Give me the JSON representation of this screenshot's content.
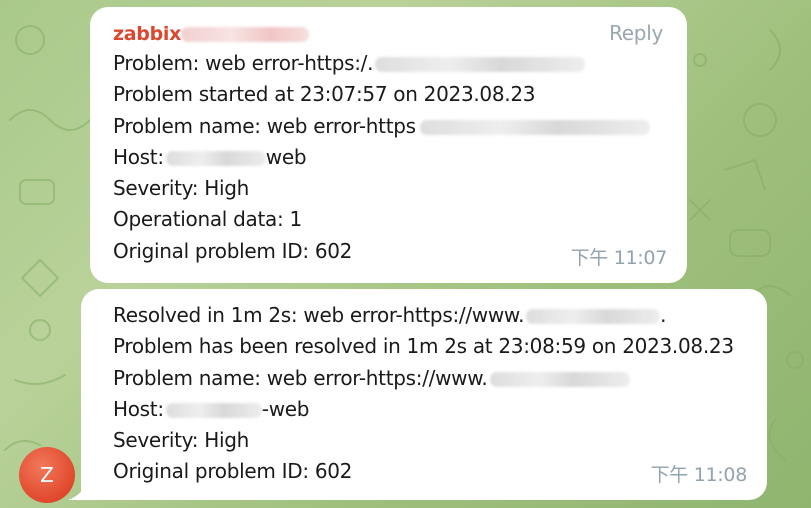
{
  "colors": {
    "wallpaper": "#a9c98a",
    "bubble": "#ffffff",
    "sender": "#d9482f",
    "meta": "#93a3ae",
    "avatar": "#e0482c"
  },
  "message_1": {
    "sender": "zabbix",
    "reply_label": "Reply",
    "lines": {
      "problem": "Problem: web error-https:/.",
      "started": "Problem started at 23:07:57 on 2023.08.23",
      "name": "Problem name: web error-https",
      "host_prefix": "Host:",
      "host_suffix": "web",
      "severity": "Severity: High",
      "operational": "Operational data: 1",
      "original_id": "Original problem ID: 602"
    },
    "time": "下午 11:07"
  },
  "message_2": {
    "lines": {
      "resolved_in": "Resolved in 1m 2s: web error-https://www.",
      "resolved_in_end": ".",
      "resolved_at": "Problem has been resolved in 1m 2s at 23:08:59 on 2023.08.23",
      "name": "Problem name: web error-https://www.",
      "host_prefix": "Host:",
      "host_suffix": "-web",
      "severity": "Severity: High",
      "original_id": "Original problem ID: 602"
    },
    "time": "下午 11:08"
  },
  "avatar": {
    "initial": "Z",
    "icon": "user-avatar-icon"
  }
}
